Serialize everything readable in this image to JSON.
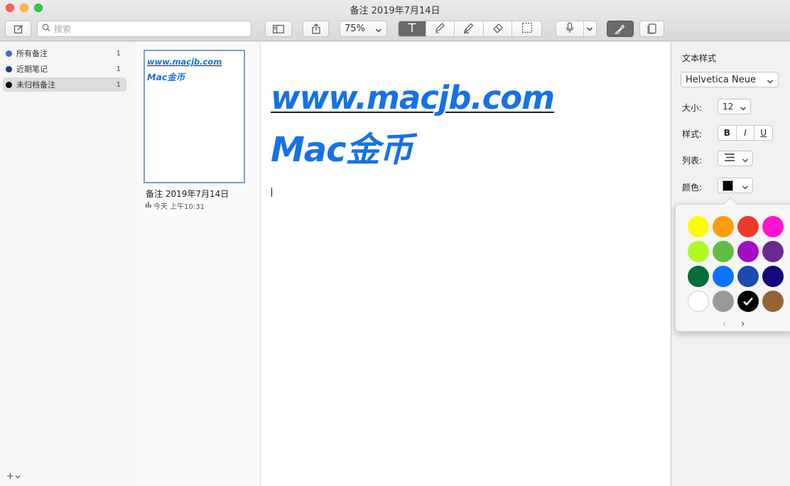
{
  "window": {
    "title": "备注 2019年7月14日"
  },
  "toolbar": {
    "search_placeholder": "搜索",
    "zoom_value": "75%"
  },
  "sidebar": {
    "items": [
      {
        "label": "所有备注",
        "count": "1",
        "dot_color": "#3e6bc9"
      },
      {
        "label": "近期笔记",
        "count": "1",
        "dot_color": "#243b78"
      },
      {
        "label": "未归档备注",
        "count": "1",
        "dot_color": "#111111"
      }
    ],
    "add_label": "+"
  },
  "note_list": {
    "thumb_line1": "www.macjb.com",
    "thumb_line2": "Mac金币",
    "note_name": "备注 2019年7月14日",
    "note_time": "今天 上午10:31"
  },
  "editor": {
    "line1": "www.macjb.com",
    "line2": "Mac金币",
    "text_color": "#1771e6"
  },
  "inspector": {
    "title": "文本样式",
    "font": "Helvetica Neue",
    "size_label": "大小:",
    "size_value": "12",
    "style_label": "样式:",
    "style_bold": "B",
    "style_italic": "I",
    "style_underline": "U",
    "list_label": "列表:",
    "color_label": "颜色:",
    "current_color": "#000000"
  },
  "palette": {
    "colors": [
      "#fbfc03",
      "#fd9c11",
      "#ee3a2a",
      "#fc14d0",
      "#aef923",
      "#62bd44",
      "#a50cc5",
      "#682b91",
      "#056f37",
      "#0d73fb",
      "#1d4aad",
      "#120a7a",
      "#ffffff",
      "#999999",
      "#000000",
      "#936536"
    ],
    "selected_index": 14,
    "prev_label": "‹",
    "next_label": "›"
  }
}
